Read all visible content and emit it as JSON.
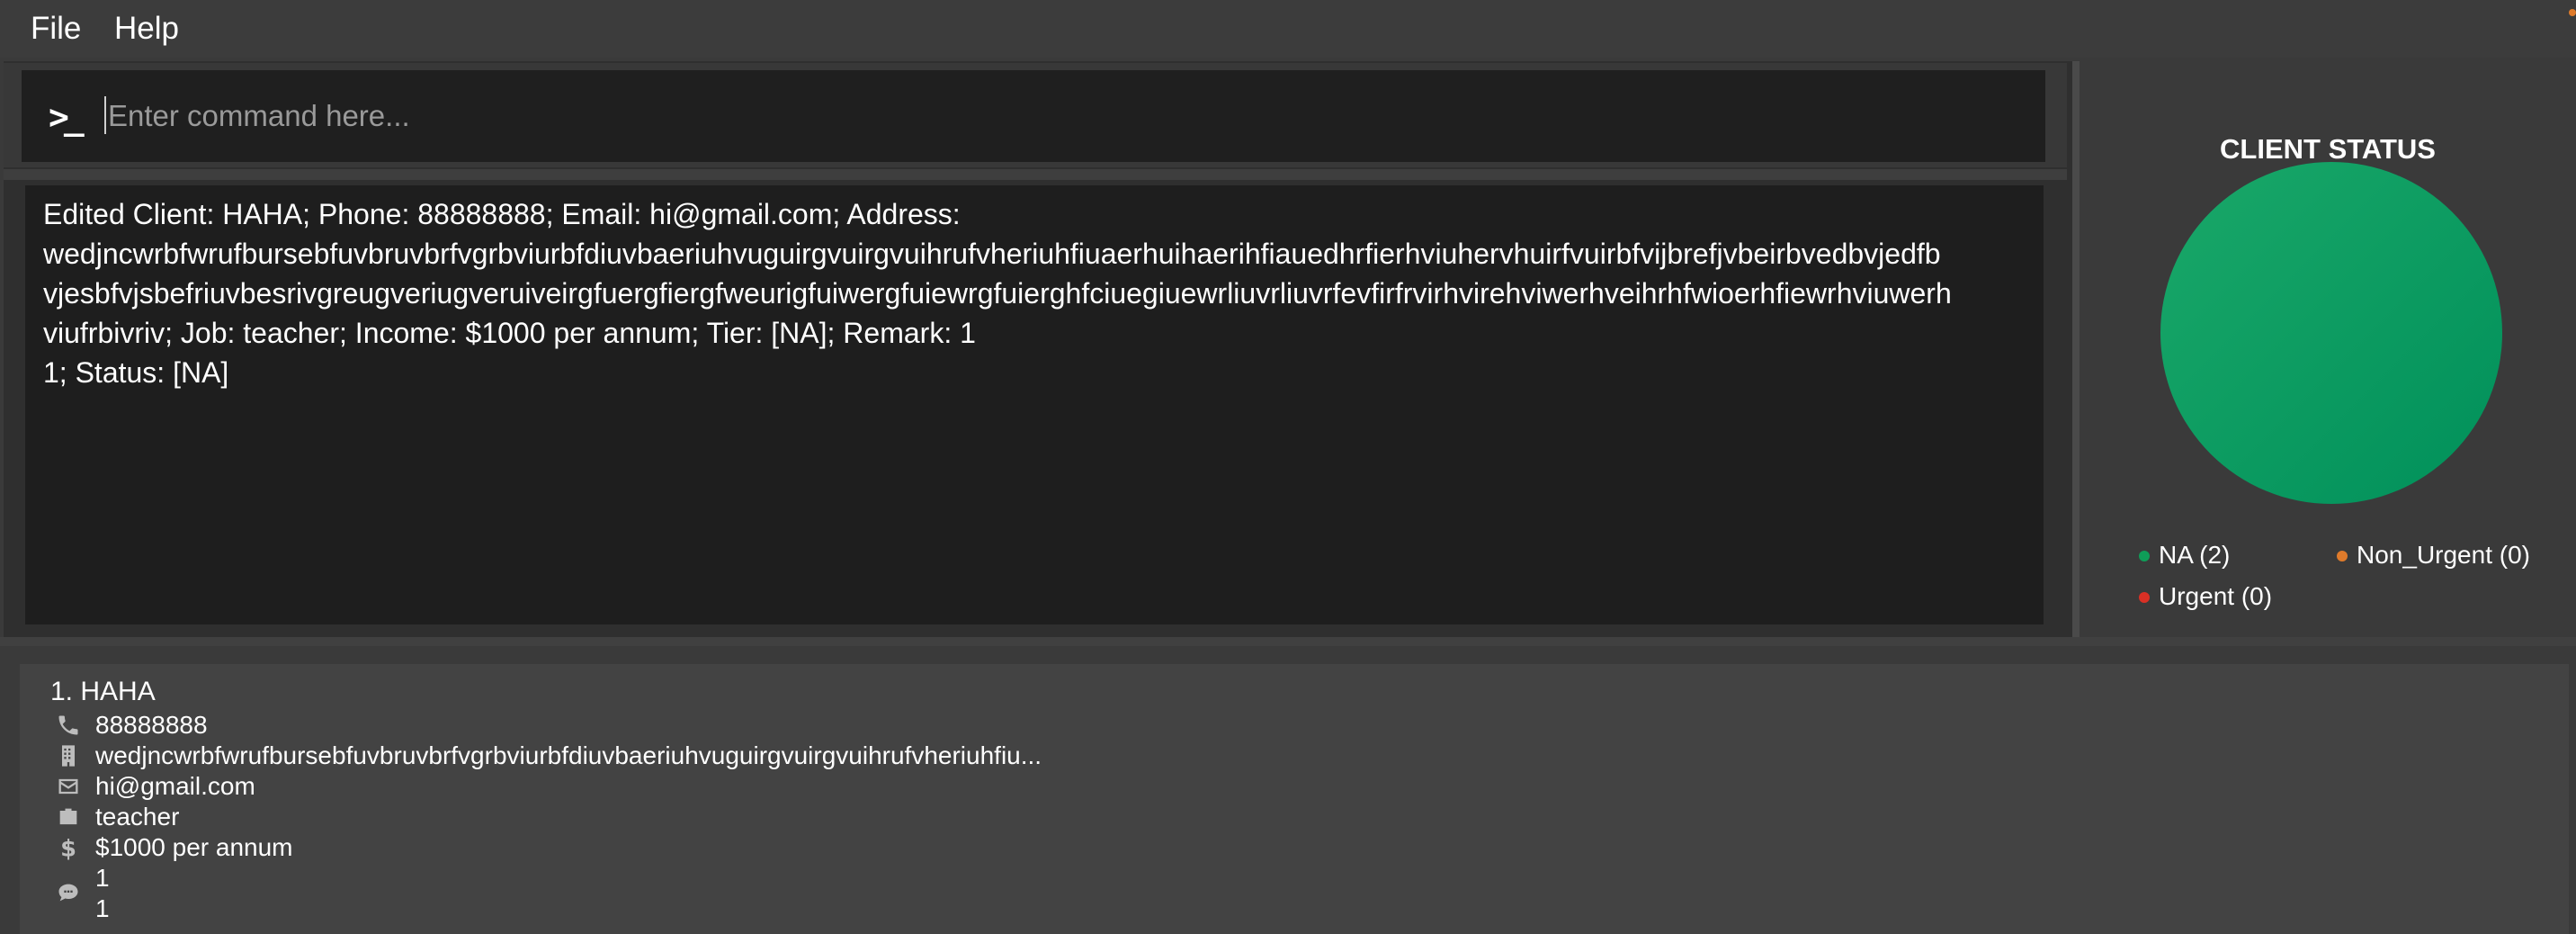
{
  "menu": {
    "file": "File",
    "help": "Help"
  },
  "command": {
    "placeholder": "Enter command here..."
  },
  "result": {
    "lines": [
      "Edited Client: HAHA; Phone: 88888888; Email: hi@gmail.com; Address:",
      "wedjncwrbfwrufbursebfuvbruvbrfvgrbviurbfdiuvbaeriuhvuguirgvuirgvuihrufvheriuhfiuaerhuihaerihfiauedhrfierhviuhervhuirfvuirbfvijbrefjvbeirbvedbvjedfb",
      "vjesbfvjsbefriuvbesrivgreugveriugveruiveirgfuergfiergfweurigfuiwergfuiewrgfuierghfciuegiuewrliuvrliuvrfevfirfrvirhvirehviwerhveihrhfwioerhfiewrhviuwerh",
      "viufrbivriv; Job: teacher; Income: $1000 per annum; Tier: [NA]; Remark: 1",
      "1; Status: [NA]"
    ]
  },
  "status": {
    "title": "CLIENT STATUS",
    "legend": [
      {
        "label": "NA (2)",
        "color": "#0f9d58"
      },
      {
        "label": "Non_Urgent (0)",
        "color": "#e07b2b"
      },
      {
        "label": "Urgent (0)",
        "color": "#d93025"
      }
    ],
    "chart_colors": {
      "na_start": "#1aa869",
      "na_end": "#00905a"
    }
  },
  "client_card": {
    "name": "1. HAHA",
    "phone": "88888888",
    "address": "wedjncwrbfwrufbursebfuvbruvbrfvgrbviurbfdiuvbaeriuhvuguirgvuirgvuihrufvheriuhfiu...",
    "email": "hi@gmail.com",
    "job": "teacher",
    "income": "$1000 per annum",
    "remark": "1",
    "status_line": "1"
  },
  "colors": {
    "background": "#3a3a3a",
    "panel_dark": "#1e1e1e",
    "accent_green": "#0f9d58"
  }
}
